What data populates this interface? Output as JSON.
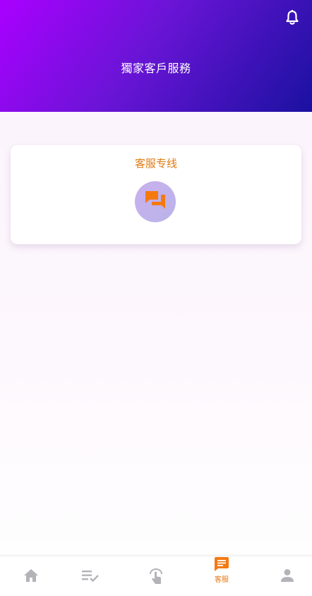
{
  "header": {
    "title": "獨家客戶服務",
    "bell_icon": "bell-icon"
  },
  "card": {
    "title": "客服专线",
    "icon": "chat-bubbles-icon"
  },
  "tabbar": {
    "active_label": "客服",
    "tabs": [
      {
        "icon": "home-icon"
      },
      {
        "icon": "checklist-icon"
      },
      {
        "icon": "tap-hand-icon"
      },
      {
        "icon": "message-icon"
      },
      {
        "icon": "person-icon"
      }
    ]
  },
  "colors": {
    "accent": "#e57a16",
    "header_start": "#aa00ff",
    "header_end": "#1a11a0",
    "inactive_icon": "#b3b3b8"
  }
}
